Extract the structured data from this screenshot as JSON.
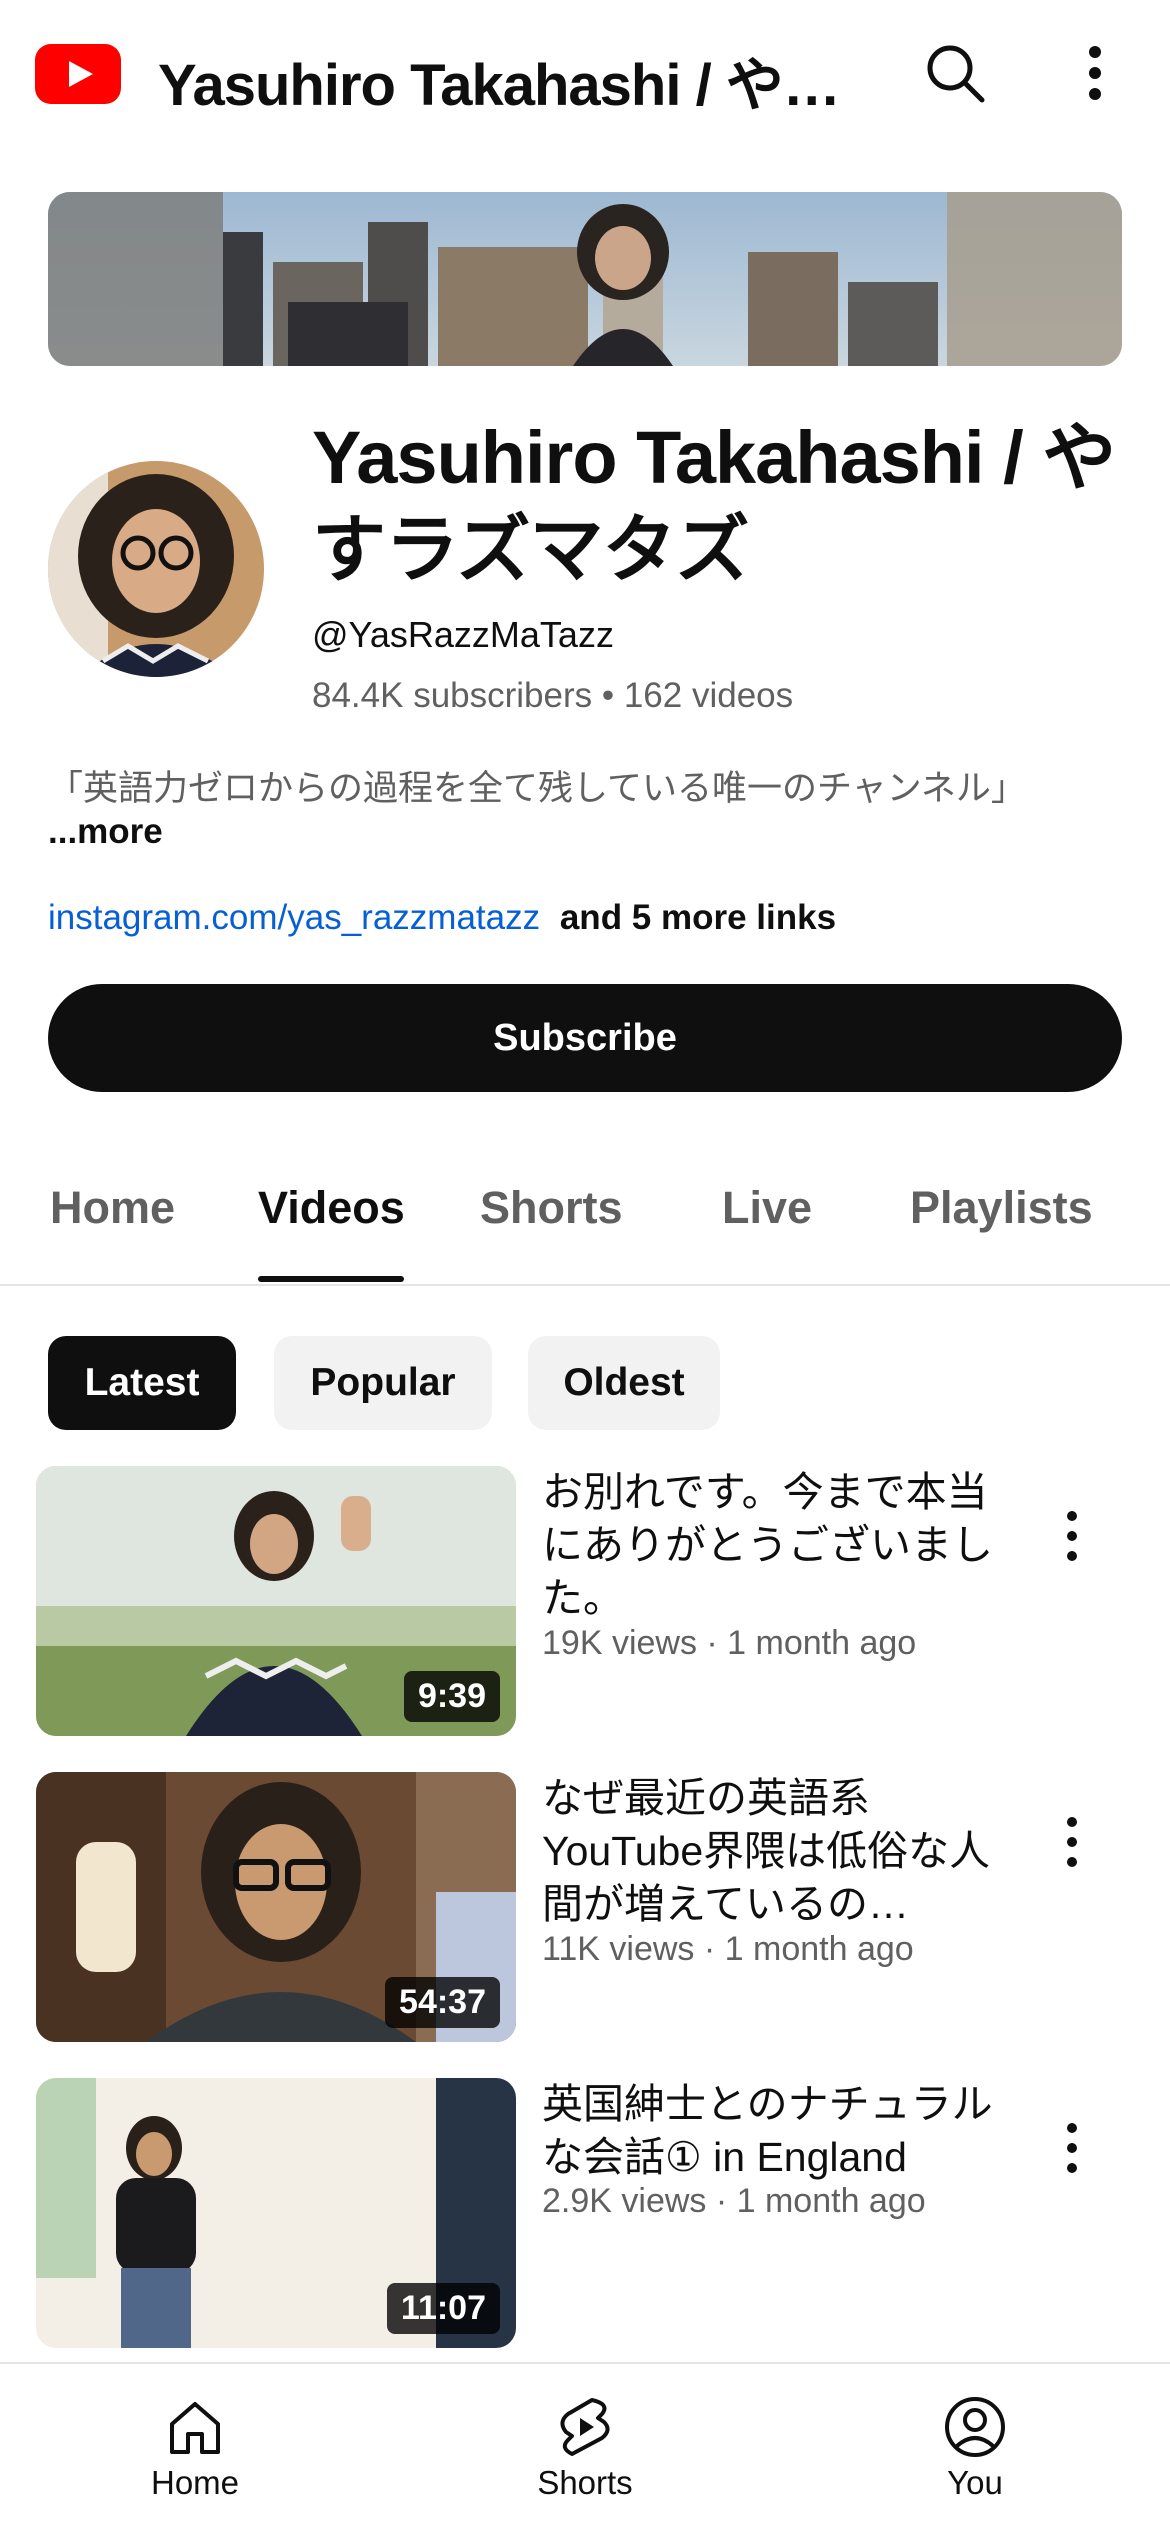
{
  "header": {
    "title": "Yasuhiro Takahashi / や…"
  },
  "channel": {
    "name": "Yasuhiro Takahashi / やすラズマタズ",
    "handle": "@YasRazzMaTazz",
    "stats": "84.4K subscribers • 162 videos",
    "description": "「英語力ゼロからの過程を全て残している唯一のチャンネル」",
    "more_label": "...more",
    "link_url": "instagram.com/yas_razzmatazz",
    "link_more": "and 5 more links",
    "subscribe_label": "Subscribe"
  },
  "tabs": [
    {
      "label": "Home"
    },
    {
      "label": "Videos"
    },
    {
      "label": "Shorts"
    },
    {
      "label": "Live"
    },
    {
      "label": "Playlists"
    }
  ],
  "active_tab": "Videos",
  "chips": [
    {
      "label": "Latest"
    },
    {
      "label": "Popular"
    },
    {
      "label": "Oldest"
    }
  ],
  "videos": [
    {
      "title": "お別れです。今まで本当にありがとうございました。",
      "meta": "19K views · 1 month ago",
      "duration": "9:39"
    },
    {
      "title": "なぜ最近の英語系YouTube界隈は低俗な人間が増えているの…",
      "meta": "11K views · 1 month ago",
      "duration": "54:37"
    },
    {
      "title": "英国紳士とのナチュラルな会話① in England",
      "meta": "2.9K views · 1 month ago",
      "duration": "11:07"
    }
  ],
  "bottom_nav": [
    {
      "label": "Home",
      "icon": "home-icon"
    },
    {
      "label": "Shorts",
      "icon": "shorts-icon"
    },
    {
      "label": "You",
      "icon": "you-icon"
    }
  ],
  "colors": {
    "brand_red": "#ff0000",
    "link_blue": "#065fd4",
    "text_primary": "#0f0f0f",
    "text_secondary": "#606060"
  }
}
